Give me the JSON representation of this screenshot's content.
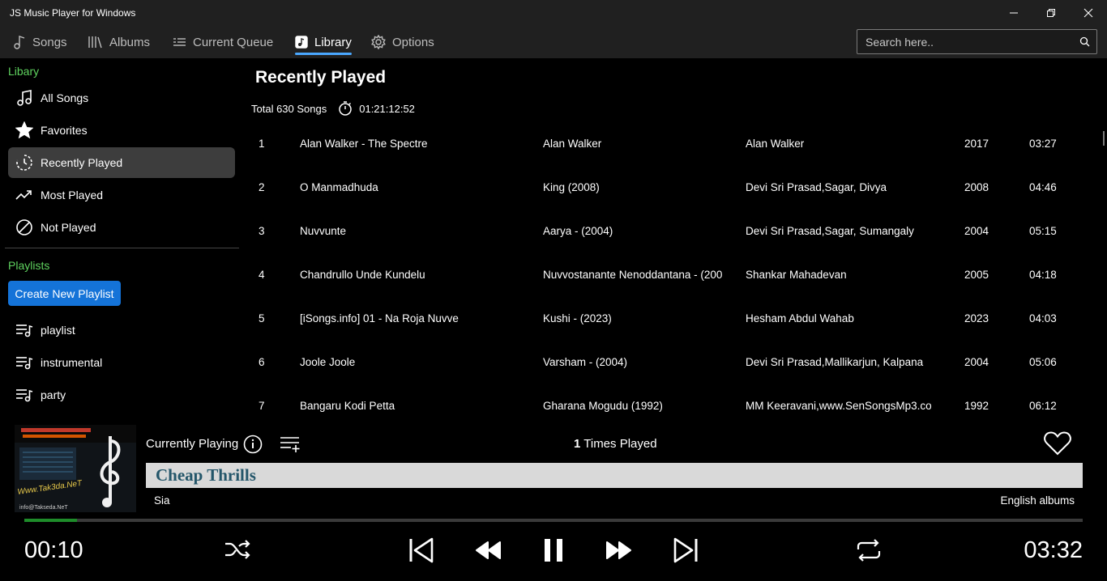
{
  "window": {
    "title": "JS Music Player for Windows"
  },
  "nav": {
    "tabs": [
      {
        "label": "Songs",
        "icon": "music-note-icon"
      },
      {
        "label": "Albums",
        "icon": "albums-icon"
      },
      {
        "label": "Current Queue",
        "icon": "queue-icon"
      },
      {
        "label": "Library",
        "icon": "library-icon"
      },
      {
        "label": "Options",
        "icon": "gear-icon"
      }
    ],
    "active_tab": "Library",
    "accent": "#4aa8ff"
  },
  "search": {
    "placeholder": "Search here.."
  },
  "sidebar": {
    "library_label": "Libary",
    "items": [
      {
        "label": "All Songs",
        "icon": "music-note-icon"
      },
      {
        "label": "Favorites",
        "icon": "star-icon"
      },
      {
        "label": "Recently Played",
        "icon": "clock-icon"
      },
      {
        "label": "Most Played",
        "icon": "trending-up-icon"
      },
      {
        "label": "Not Played",
        "icon": "block-icon"
      }
    ],
    "active_item": "Recently Played",
    "playlists_label": "Playlists",
    "create_playlist_label": "Create New Playlist",
    "playlists": [
      "playlist",
      "instrumental",
      "party"
    ],
    "section_color": "#5fd35f"
  },
  "main": {
    "title": "Recently Played",
    "total_songs": "Total 630 Songs",
    "total_duration": "01:21:12:52",
    "songs": [
      {
        "num": "1",
        "title": "Alan Walker - The Spectre",
        "album": "Alan Walker",
        "artist": "Alan Walker",
        "year": "2017",
        "duration": "03:27"
      },
      {
        "num": "2",
        "title": "O Manmadhuda",
        "album": "King (2008)",
        "artist": "Devi Sri Prasad,Sagar, Divya",
        "year": "2008",
        "duration": "04:46"
      },
      {
        "num": "3",
        "title": "Nuvvunte",
        "album": "Aarya - (2004)",
        "artist": "Devi Sri Prasad,Sagar, Sumangaly",
        "year": "2004",
        "duration": "05:15"
      },
      {
        "num": "4",
        "title": "Chandrullo Unde Kundelu",
        "album": "Nuvvostanante Nenoddantana - (200",
        "artist": "Shankar Mahadevan",
        "year": "2005",
        "duration": "04:18"
      },
      {
        "num": "5",
        "title": "[iSongs.info] 01 - Na Roja Nuvve",
        "album": "Kushi - (2023)",
        "artist": "Hesham Abdul Wahab",
        "year": "2023",
        "duration": "04:03"
      },
      {
        "num": "6",
        "title": "Joole Joole",
        "album": "Varsham - (2004)",
        "artist": "Devi Sri Prasad,Mallikarjun, Kalpana",
        "year": "2004",
        "duration": "05:06"
      },
      {
        "num": "7",
        "title": "Bangaru Kodi Petta",
        "album": "Gharana Mogudu (1992)",
        "artist": "MM Keeravani,www.SenSongsMp3.co",
        "year": "1992",
        "duration": "06:12"
      }
    ]
  },
  "player": {
    "currently_playing_label": "Currently Playing",
    "times_played_count": "1",
    "times_played_label": "Times Played",
    "song_title": "Cheap Thrills",
    "artist": "Sia",
    "album_tag": "English albums",
    "current_time": "00:10",
    "total_time": "03:32",
    "progress": 0.05,
    "progress_color": "#1e8c2a",
    "art_text_line1": "Www.Tak3da.NeT",
    "art_text_line2": "info@Takseda.NeT"
  }
}
